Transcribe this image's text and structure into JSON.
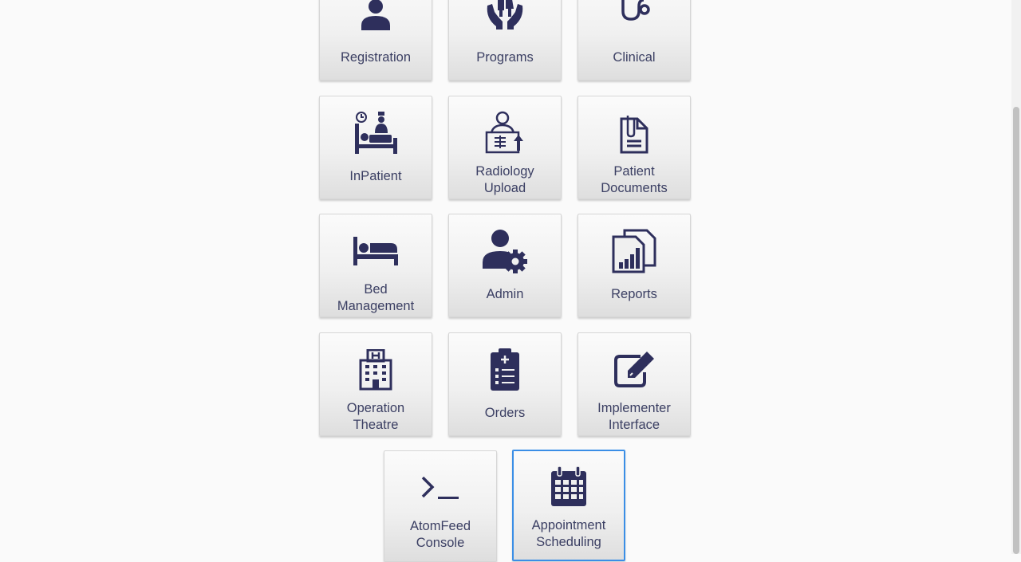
{
  "tiles": [
    {
      "label": "Registration",
      "icon": "user-icon"
    },
    {
      "label": "Programs",
      "icon": "family-hands-icon"
    },
    {
      "label": "Clinical",
      "icon": "stethoscope-icon"
    },
    {
      "label": "InPatient",
      "icon": "inpatient-icon"
    },
    {
      "label": "Radiology\nUpload",
      "icon": "radiology-icon"
    },
    {
      "label": "Patient\nDocuments",
      "icon": "document-clip-icon"
    },
    {
      "label": "Bed\nManagement",
      "icon": "bed-icon"
    },
    {
      "label": "Admin",
      "icon": "user-gear-icon"
    },
    {
      "label": "Reports",
      "icon": "reports-chart-icon"
    },
    {
      "label": "Operation\nTheatre",
      "icon": "hospital-icon"
    },
    {
      "label": "Orders",
      "icon": "clipboard-list-icon"
    },
    {
      "label": "Implementer\nInterface",
      "icon": "edit-pencil-icon"
    },
    {
      "label": "AtomFeed\nConsole",
      "icon": "terminal-icon"
    },
    {
      "label": "Appointment\nScheduling",
      "icon": "calendar-icon"
    }
  ],
  "selected_tile": "Appointment\nScheduling",
  "colors": {
    "icon": "#2e2f5c",
    "text": "#3b3f63",
    "selected_border": "#3a8ee6"
  }
}
